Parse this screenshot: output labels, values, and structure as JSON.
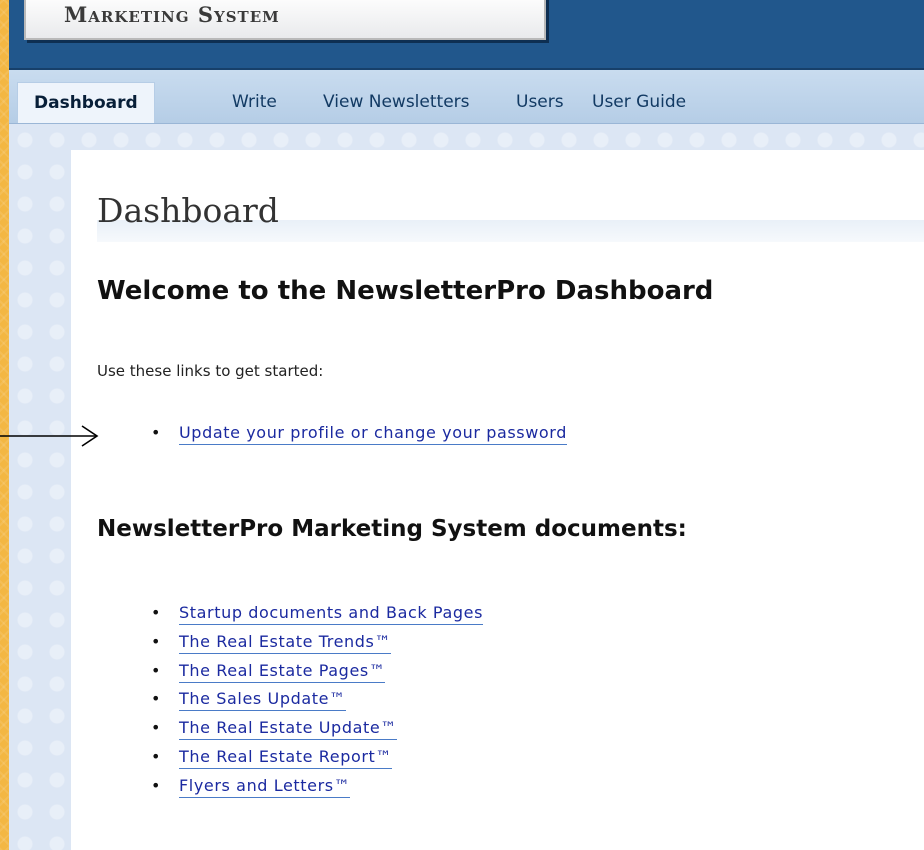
{
  "header": {
    "logo_text": "Marketing System"
  },
  "nav": {
    "items": [
      {
        "label": "Dashboard",
        "active": true
      },
      {
        "label": "Write"
      },
      {
        "label": "View Newsletters"
      },
      {
        "label": "Users"
      },
      {
        "label": "User Guide"
      }
    ]
  },
  "main": {
    "page_title": "Dashboard",
    "welcome_heading": "Welcome to the NewsletterPro Dashboard",
    "intro": "Use these links to get started:",
    "profile_link": "Update your profile or change your password",
    "docs_heading": "NewsletterPro Marketing System documents:",
    "docs_links": [
      "Startup documents and Back Pages",
      "The Real Estate Trends™",
      "The Real Estate Pages™",
      "The Sales Update™",
      "The Real Estate Update™",
      "The Real Estate Report™",
      "Flyers and Letters™"
    ]
  },
  "colors": {
    "header_bg": "#21578c",
    "nav_bg": "#c2d7ec",
    "link": "#1b2aa0",
    "slide_bg": "#f3b743"
  },
  "annotation": {
    "arrow_icon": "right-arrow-icon"
  }
}
